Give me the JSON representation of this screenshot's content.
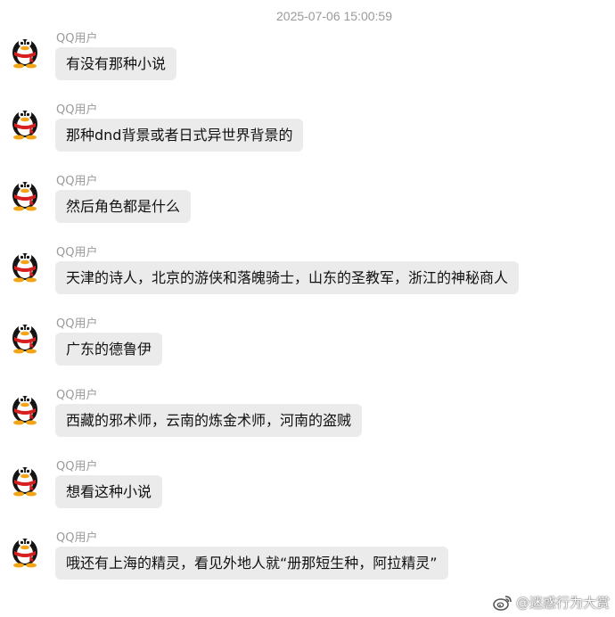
{
  "timestamp": "2025-07-06 15:00:59",
  "messages": [
    {
      "sender": "QQ用户",
      "text": "有没有那种小说"
    },
    {
      "sender": "QQ用户",
      "text": "那种dnd背景或者日式异世界背景的"
    },
    {
      "sender": "QQ用户",
      "text": "然后角色都是什么"
    },
    {
      "sender": "QQ用户",
      "text": "天津的诗人，北京的游侠和落魄骑士，山东的圣教军，浙江的神秘商人"
    },
    {
      "sender": "QQ用户",
      "text": "广东的德鲁伊"
    },
    {
      "sender": "QQ用户",
      "text": "西藏的邪术师，云南的炼金术师，河南的盗贼"
    },
    {
      "sender": "QQ用户",
      "text": "想看这种小说"
    },
    {
      "sender": "QQ用户",
      "text": "哦还有上海的精灵，看见外地人就“册那短生种，阿拉精灵”"
    }
  ],
  "watermark": {
    "handle": "@迷惑行为大赏",
    "icon": "weibo-icon"
  },
  "avatar_icon": "qq-penguin-icon",
  "colors": {
    "bubble": "#ebebeb",
    "meta_text": "#9a9a9a",
    "text": "#111111"
  }
}
